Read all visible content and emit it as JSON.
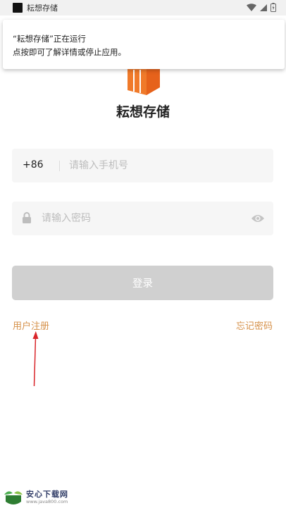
{
  "status_bar": {
    "app_title": "耘想存储"
  },
  "notification": {
    "line1": "“耘想存储”正在运行",
    "line2": "点按即可了解详情或停止应用。"
  },
  "app": {
    "name": "耘想存储"
  },
  "login_form": {
    "country_code": "+86",
    "phone_placeholder": "请输入手机号",
    "password_placeholder": "请输入密码",
    "login_label": "登录"
  },
  "links": {
    "register": "用户注册",
    "forgot_password": "忘记密码"
  },
  "watermark": {
    "brand": "安心下载网",
    "url": "www.java800.com"
  },
  "colors": {
    "accent": "#d6914a",
    "logo_orange": "#f07a2a",
    "button_disabled": "#d0d0d0",
    "arrow": "#d9252a"
  }
}
